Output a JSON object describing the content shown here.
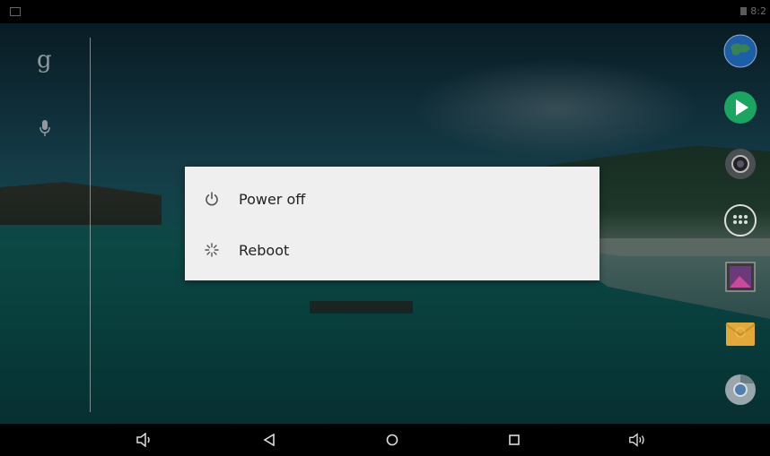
{
  "status_bar": {
    "time": "8:2"
  },
  "power_menu": {
    "items": [
      {
        "label": "Power off",
        "icon": "power-icon"
      },
      {
        "label": "Reboot",
        "icon": "reboot-icon"
      }
    ]
  },
  "home": {
    "search_icon_glyph": "g",
    "dock_icons": [
      "browser-icon",
      "play-store-icon",
      "camera-icon",
      "app-drawer-icon",
      "gallery-icon",
      "email-icon",
      "chrome-icon"
    ]
  },
  "nav_bar": {
    "buttons": [
      "volume-down-icon",
      "back-icon",
      "home-icon",
      "recents-icon",
      "volume-up-icon"
    ]
  },
  "colors": {
    "dialog_bg": "#efefef",
    "play_store_green": "#1aa560",
    "email_yellow": "#e2a93a"
  }
}
